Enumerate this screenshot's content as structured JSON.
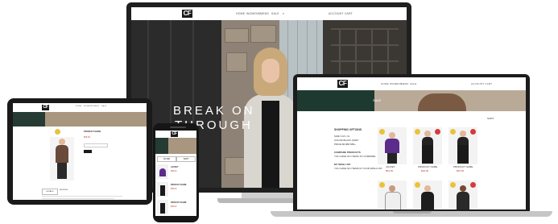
{
  "brand": {
    "logo_text": "CF"
  },
  "desktop": {
    "nav_items": [
      "HOME",
      "WOMENS",
      "MENS",
      "SALE"
    ],
    "header_right": "ACCOUNT  CART",
    "hero_line1": "BREAK ON",
    "hero_line2": "THROUGH"
  },
  "laptop": {
    "nav_items": [
      "HOME",
      "WOMENS",
      "MENS",
      "SALE"
    ],
    "header_right": "ACCOUNT  CART",
    "banner_text": "SALE",
    "sort_label": "SORT",
    "sidebar": {
      "title": "SHOPPING OPTIONS",
      "groups": [
        "SIZE",
        "COLOR",
        "PRICE"
      ],
      "lines": [
        "SIZE  S  M  L  XL",
        "COLOR  BLACK  GREY",
        "PRICE  $0-$50  $50+"
      ],
      "compare_title": "COMPARE PRODUCTS",
      "compare_text": "YOU HAVE NO ITEMS TO COMPARE.",
      "wishlist_title": "MY WISH LIST",
      "wishlist_text": "YOU HAVE NO ITEMS IN YOUR WISH LIST."
    },
    "products": [
      {
        "name": "JACKET",
        "price": "$59.00"
      },
      {
        "name": "PRODUCT NAME",
        "price": "$39.00"
      },
      {
        "name": "PRODUCT NAME",
        "price": "$39.00"
      }
    ]
  },
  "tablet": {
    "product_title": "PRODUCT NAME",
    "price": "$65.00",
    "tab_labels": [
      "DETAILS",
      "REVIEWS"
    ]
  },
  "phone": {
    "filter_label": "FILTER",
    "sort_label": "SORT",
    "items": [
      {
        "name": "JACKET",
        "price": "$59.00"
      },
      {
        "name": "PRODUCT NAME",
        "price": "$39.00"
      },
      {
        "name": "PRODUCT NAME",
        "price": "$39.00"
      }
    ]
  },
  "colors": {
    "accent_red": "#d33c3c",
    "accent_yellow": "#e9c23c",
    "banner_green": "#1e3a30",
    "bezel": "#1c1c1c"
  },
  "icons": [
    "search-icon",
    "cart-icon",
    "account-icon",
    "sale-badge-icon"
  ]
}
